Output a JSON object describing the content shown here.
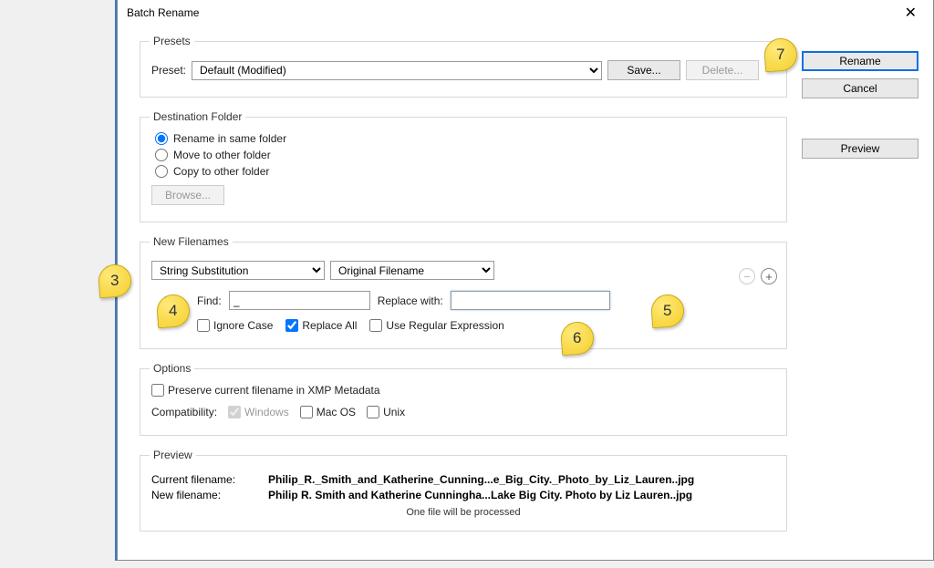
{
  "window": {
    "title": "Batch Rename"
  },
  "presets": {
    "legend": "Presets",
    "label": "Preset:",
    "value": "Default (Modified)",
    "save": "Save...",
    "delete": "Delete..."
  },
  "destination": {
    "legend": "Destination Folder",
    "opt1": "Rename in same folder",
    "opt2": "Move to other folder",
    "opt3": "Copy to other folder",
    "browse": "Browse..."
  },
  "newfilenames": {
    "legend": "New Filenames",
    "method": "String Substitution",
    "source": "Original Filename",
    "find_label": "Find:",
    "find_value": "_",
    "replace_label": "Replace with:",
    "replace_value": "",
    "ignore_case": "Ignore Case",
    "replace_all": "Replace All",
    "use_regex": "Use Regular Expression"
  },
  "options": {
    "legend": "Options",
    "preserve": "Preserve current filename in XMP Metadata",
    "compat_label": "Compatibility:",
    "windows": "Windows",
    "macos": "Mac OS",
    "unix": "Unix"
  },
  "preview": {
    "legend": "Preview",
    "cur_label": "Current filename:",
    "cur_value": "Philip_R._Smith_and_Katherine_Cunning...e_Big_City._Photo_by_Liz_Lauren..jpg",
    "new_label": "New filename:",
    "new_value": "Philip R. Smith and Katherine Cunningha...Lake Big City. Photo by Liz Lauren..jpg",
    "note": "One file will be processed"
  },
  "buttons": {
    "rename": "Rename",
    "cancel": "Cancel",
    "preview": "Preview"
  },
  "callouts": {
    "c3": "3",
    "c4": "4",
    "c5": "5",
    "c6": "6",
    "c7": "7"
  }
}
